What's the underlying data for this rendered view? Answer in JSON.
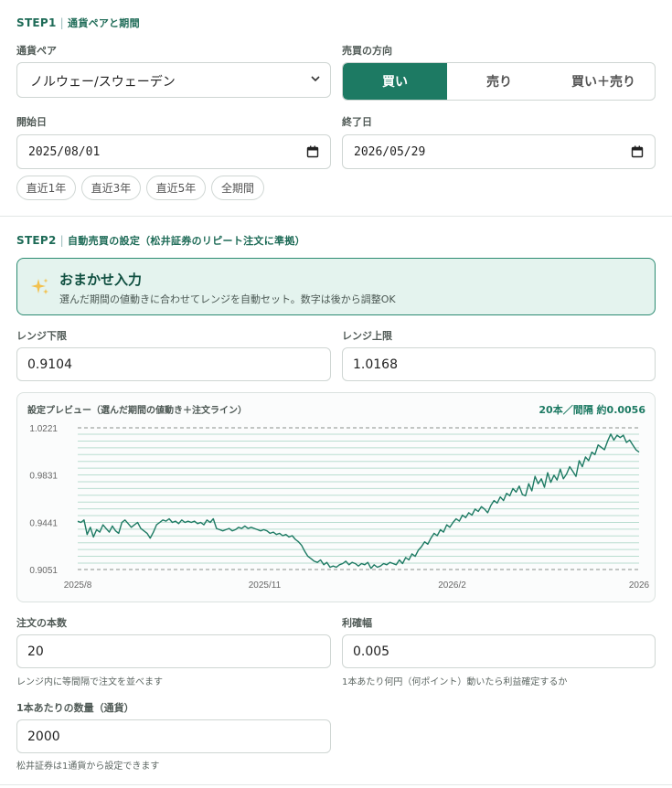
{
  "step1": {
    "step": "STEP1",
    "title": "通貨ペアと期間",
    "pair_label": "通貨ペア",
    "pair_value": "ノルウェー/スウェーデン",
    "direction_label": "売買の方向",
    "directions": [
      "買い",
      "売り",
      "買い＋売り"
    ],
    "direction_selected": "買い",
    "start_label": "開始日",
    "start_value": "2025/08/01",
    "end_label": "終了日",
    "end_value": "2026/05/29",
    "presets": [
      "直近1年",
      "直近3年",
      "直近5年",
      "全期間"
    ]
  },
  "step2": {
    "step": "STEP2",
    "title": "自動売買の設定（松井証券のリピート注文に準拠）",
    "auto": {
      "title": "おまかせ入力",
      "desc": "選んだ期間の値動きに合わせてレンジを自動セット。数字は後から調整OK",
      "icon": "sparkles-icon"
    },
    "range_low_label": "レンジ下限",
    "range_low_value": "0.9104",
    "range_high_label": "レンジ上限",
    "range_high_value": "1.0168",
    "orders_label": "注文の本数",
    "orders_value": "20",
    "orders_hint": "レンジ内に等間隔で注文を並べます",
    "profit_label": "利確幅",
    "profit_value": "0.005",
    "profit_hint": "1本あたり何円（何ポイント）動いたら利益確定するか",
    "qty_label": "1本あたりの数量（通貨）",
    "qty_value": "2000",
    "qty_hint": "松井証券は1通貨から設定できます"
  },
  "chart_data": {
    "type": "line",
    "title": "設定プレビュー（選んだ期間の値動き＋注文ライン）",
    "meta": "20本／間隔 約0.0056",
    "y_ticks": [
      "1.0221",
      "0.9831",
      "0.9441",
      "0.9051"
    ],
    "ylim": [
      0.9051,
      1.0221
    ],
    "x_ticks": [
      "2025/8",
      "2025/11",
      "2026/2",
      "2026"
    ],
    "order_lines": {
      "count": 20,
      "low": 0.9104,
      "high": 1.0168
    },
    "color": "#1d7a63",
    "series": [
      {
        "values": [
          0.945,
          0.944,
          0.946,
          0.934,
          0.94,
          0.932,
          0.938,
          0.936,
          0.942,
          0.939,
          0.936,
          0.941,
          0.937,
          0.935,
          0.944,
          0.946,
          0.943,
          0.94,
          0.942,
          0.944,
          0.939,
          0.937,
          0.935,
          0.931,
          0.936,
          0.942,
          0.944,
          0.946,
          0.945,
          0.947,
          0.944,
          0.945,
          0.943,
          0.946,
          0.944,
          0.945,
          0.944,
          0.945,
          0.943,
          0.944,
          0.942,
          0.946,
          0.944,
          0.947,
          0.939,
          0.938,
          0.937,
          0.938,
          0.939,
          0.937,
          0.938,
          0.94,
          0.939,
          0.941,
          0.939,
          0.94,
          0.939,
          0.938,
          0.937,
          0.938,
          0.937,
          0.935,
          0.936,
          0.934,
          0.935,
          0.933,
          0.934,
          0.932,
          0.933,
          0.93,
          0.928,
          0.925,
          0.92,
          0.916,
          0.914,
          0.912,
          0.911,
          0.913,
          0.909,
          0.911,
          0.907,
          0.908,
          0.907,
          0.909,
          0.91,
          0.912,
          0.909,
          0.911,
          0.91,
          0.908,
          0.91,
          0.909,
          0.911,
          0.906,
          0.909,
          0.907,
          0.908,
          0.91,
          0.909,
          0.911,
          0.91,
          0.909,
          0.913,
          0.91,
          0.915,
          0.913,
          0.918,
          0.916,
          0.921,
          0.924,
          0.928,
          0.926,
          0.931,
          0.935,
          0.933,
          0.938,
          0.936,
          0.942,
          0.94,
          0.944,
          0.947,
          0.945,
          0.95,
          0.948,
          0.952,
          0.95,
          0.955,
          0.953,
          0.957,
          0.955,
          0.952,
          0.958,
          0.962,
          0.96,
          0.965,
          0.962,
          0.968,
          0.966,
          0.972,
          0.969,
          0.974,
          0.967,
          0.966,
          0.976,
          0.97,
          0.982,
          0.976,
          0.98,
          0.973,
          0.985,
          0.977,
          0.983,
          0.979,
          0.988,
          0.98,
          0.984,
          0.99,
          0.986,
          0.982,
          0.995,
          0.99,
          0.998,
          0.995,
          1.002,
          1.0,
          1.008,
          1.006,
          1.004,
          1.011,
          1.017,
          1.012,
          1.016,
          1.014,
          1.016,
          1.01,
          1.012,
          1.008,
          1.004,
          1.002
        ]
      }
    ]
  }
}
